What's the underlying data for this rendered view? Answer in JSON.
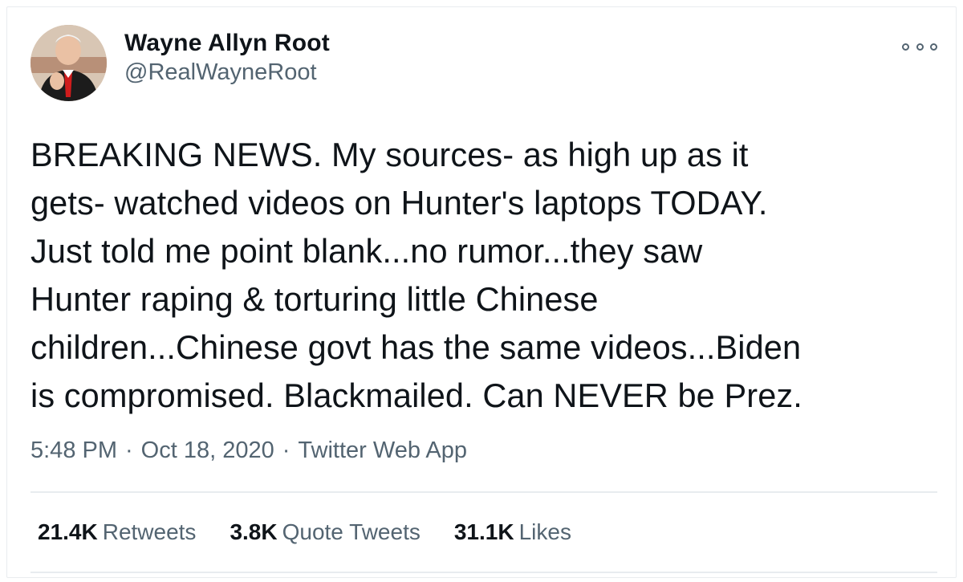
{
  "author": {
    "display_name": "Wayne Allyn Root",
    "handle": "@RealWayneRoot",
    "avatar_icon": "profile-photo"
  },
  "menu": {
    "icon": "more-options-icon"
  },
  "tweet": {
    "lines": [
      "BREAKING NEWS. My sources- as high up as it",
      "gets- watched videos on Hunter's laptops TODAY.",
      "Just told me point blank...no rumor...they saw",
      "Hunter raping & torturing little Chinese",
      "children...Chinese govt has the same videos...Biden",
      "is compromised. Blackmailed. Can NEVER be Prez."
    ]
  },
  "meta": {
    "time": "5:48 PM",
    "date": "Oct 18, 2020",
    "separator": "·",
    "source": "Twitter Web App"
  },
  "stats": {
    "retweets_count": "21.4K",
    "retweets_label": "Retweets",
    "quotes_count": "3.8K",
    "quotes_label": "Quote Tweets",
    "likes_count": "31.1K",
    "likes_label": "Likes"
  },
  "colors": {
    "text": "#0f1419",
    "secondary": "#536471",
    "divider": "#e8ecef"
  }
}
